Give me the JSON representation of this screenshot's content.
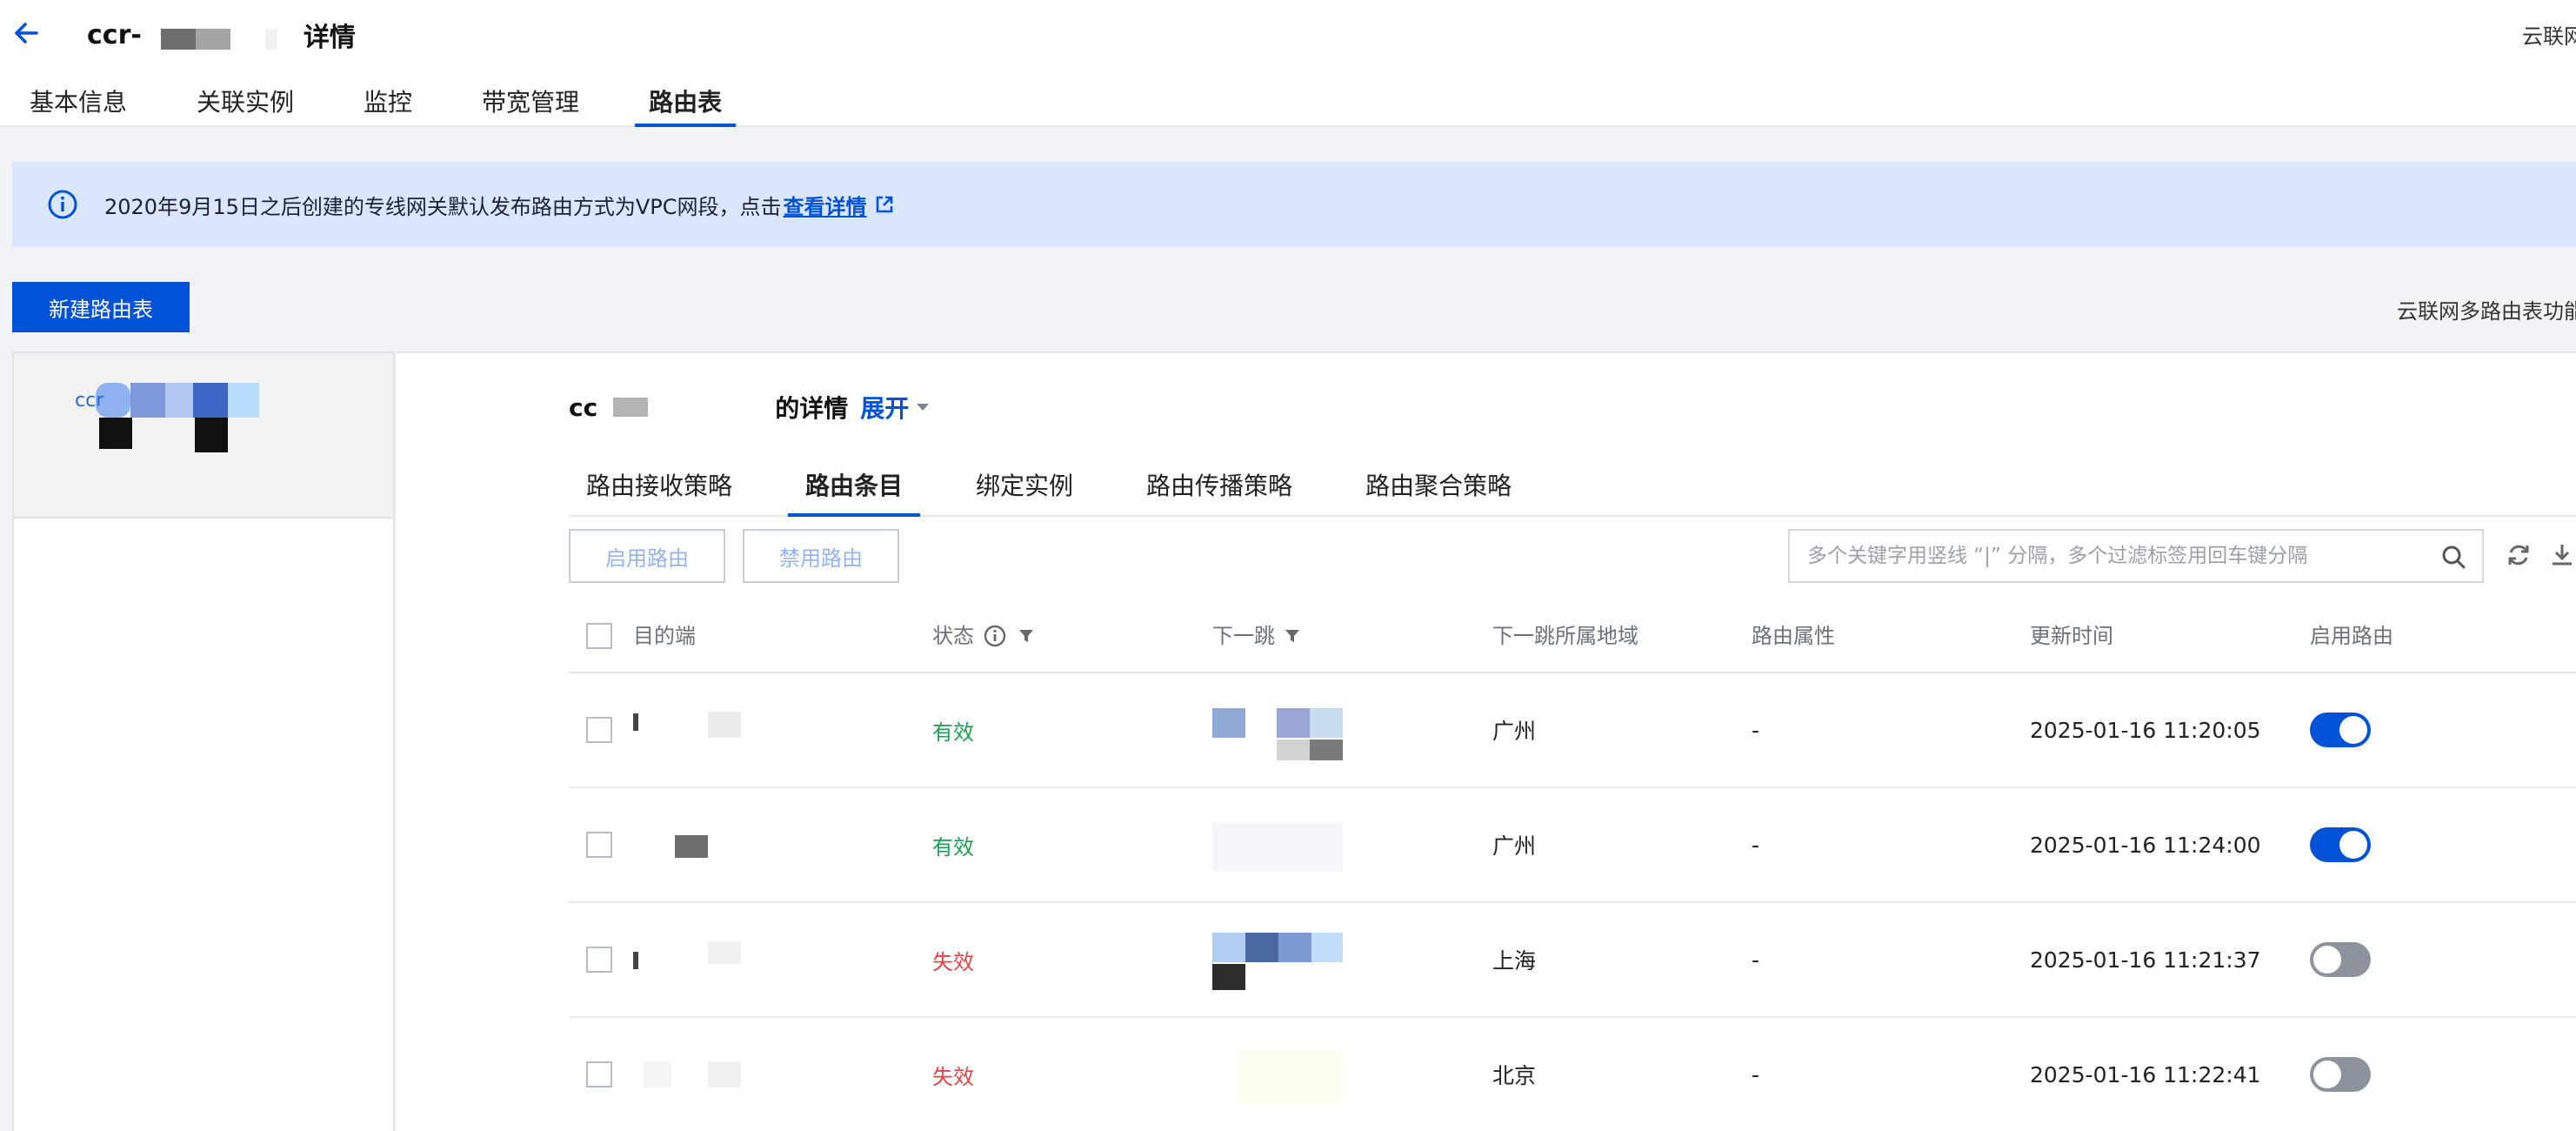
{
  "header": {
    "title_prefix": "ccr-",
    "title_suffix": "详情",
    "right_link": "云联网",
    "tabs": [
      {
        "label": "基本信息",
        "active": false
      },
      {
        "label": "关联实例",
        "active": false
      },
      {
        "label": "监控",
        "active": false
      },
      {
        "label": "带宽管理",
        "active": false
      },
      {
        "label": "路由表",
        "active": true
      }
    ]
  },
  "banner": {
    "text": "2020年9月15日之后创建的专线网关默认发布路由方式为VPC网段，点击",
    "link": "查看详情"
  },
  "toolbar": {
    "new_button": "新建路由表",
    "right_link": "云联网多路由表功能"
  },
  "left_panel": {
    "item_name": "ccr"
  },
  "detail": {
    "prefix": "cc",
    "suffix": "的详情",
    "expand": "展开",
    "subtabs": [
      {
        "label": "路由接收策略",
        "active": false
      },
      {
        "label": "路由条目",
        "active": true
      },
      {
        "label": "绑定实例",
        "active": false
      },
      {
        "label": "路由传播策略",
        "active": false
      },
      {
        "label": "路由聚合策略",
        "active": false
      }
    ],
    "enable_button": "启用路由",
    "disable_button": "禁用路由",
    "search_placeholder": "多个关键字用竖线 “|” 分隔，多个过滤标签用回车键分隔"
  },
  "table": {
    "columns": {
      "destination": "目的端",
      "status": "状态",
      "next_hop": "下一跳",
      "next_hop_region": "下一跳所属地域",
      "route_attr": "路由属性",
      "updated": "更新时间",
      "enabled": "启用路由"
    },
    "rows": [
      {
        "status": "有效",
        "status_type": "ok",
        "region": "广州",
        "attr": "-",
        "updated": "2025-01-16 11:20:05",
        "enabled": true
      },
      {
        "status": "有效",
        "status_type": "ok",
        "region": "广州",
        "attr": "-",
        "updated": "2025-01-16 11:24:00",
        "enabled": true
      },
      {
        "status": "失效",
        "status_type": "bad",
        "region": "上海",
        "attr": "-",
        "updated": "2025-01-16 11:21:37",
        "enabled": false
      },
      {
        "status": "失效",
        "status_type": "bad",
        "region": "北京",
        "attr": "-",
        "updated": "2025-01-16 11:22:41",
        "enabled": false
      }
    ]
  },
  "colors": {
    "primary": "#0052d9",
    "banner_bg": "#d9e6fd",
    "status_ok": "#1ba14f",
    "status_bad": "#e54545"
  }
}
